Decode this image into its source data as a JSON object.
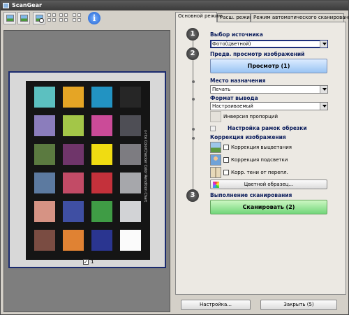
{
  "window": {
    "title": "ScanGear"
  },
  "preview": {
    "frame_label": "1",
    "frame_checked": true
  },
  "tabs": [
    {
      "label": "Основной режим"
    },
    {
      "label": "Расш. режим"
    },
    {
      "label": "Режим автоматического сканирования"
    }
  ],
  "steps": {
    "step1": {
      "number": "1",
      "title": "Выбор источника",
      "source_value": "Фото(Цветной)"
    },
    "step2": {
      "number": "2",
      "title": "Предв. просмотр изображений",
      "preview_button": "Просмотр (1)"
    },
    "destination": {
      "title": "Место назначения",
      "value": "Печать"
    },
    "output": {
      "title": "Формат вывода",
      "value": "Настраиваемый",
      "invert_label": "Инверсия пропорций"
    },
    "crop": {
      "title": "Настройка рамок обрезки"
    },
    "correction": {
      "title": "Коррекция изображения",
      "items": [
        {
          "label": "Коррекция выцветания"
        },
        {
          "label": "Коррекция подсветки"
        },
        {
          "label": "Корр. тени от перепл."
        }
      ],
      "pattern_button": "Цветной образец..."
    },
    "step3": {
      "number": "3",
      "title": "Выполнение сканирования",
      "scan_button": "Сканировать (2)"
    }
  },
  "footer": {
    "settings_button": "Настройка...",
    "close_button": "Закрыть (5)"
  },
  "checker": {
    "label": "x·rite ColorChecker Color Rendition Chart",
    "colors": [
      [
        "#5cc0c0",
        "#e5a525",
        "#2293c2",
        "#262626"
      ],
      [
        "#8b7dbc",
        "#a3c648",
        "#cb4b98",
        "#4e4e55"
      ],
      [
        "#5b7a40",
        "#6f356a",
        "#f0dc12",
        "#7d7c81"
      ],
      [
        "#5c7aa0",
        "#c24b66",
        "#c4313b",
        "#a6a7ab"
      ],
      [
        "#d69384",
        "#3f4fa3",
        "#3f9c45",
        "#d2d3d6"
      ],
      [
        "#7a4c42",
        "#e08233",
        "#2a3590",
        "#fbfbfb"
      ]
    ]
  }
}
